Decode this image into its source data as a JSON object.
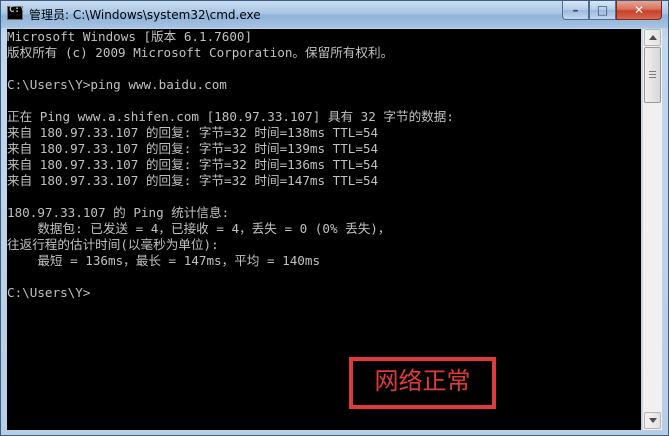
{
  "window": {
    "title": "管理员: C:\\Windows\\system32\\cmd.exe",
    "icon": "cmd-icon",
    "controls": {
      "minimize": "–",
      "maximize": "□",
      "close": "✕"
    }
  },
  "console": {
    "lines": [
      "Microsoft Windows [版本 6.1.7600]",
      "版权所有 (c) 2009 Microsoft Corporation。保留所有权利。",
      "",
      "C:\\Users\\Y>ping www.baidu.com",
      "",
      "正在 Ping www.a.shifen.com [180.97.33.107] 具有 32 字节的数据:",
      "来自 180.97.33.107 的回复: 字节=32 时间=138ms TTL=54",
      "来自 180.97.33.107 的回复: 字节=32 时间=139ms TTL=54",
      "来自 180.97.33.107 的回复: 字节=32 时间=136ms TTL=54",
      "来自 180.97.33.107 的回复: 字节=32 时间=147ms TTL=54",
      "",
      "180.97.33.107 的 Ping 统计信息:",
      "    数据包: 已发送 = 4，已接收 = 4，丢失 = 0 (0% 丢失)，",
      "往返行程的估计时间(以毫秒为单位):",
      "    最短 = 136ms，最长 = 147ms，平均 = 140ms",
      "",
      "C:\\Users\\Y>"
    ]
  },
  "annotation": {
    "text": "网络正常",
    "color": "#e03a3a"
  },
  "colors": {
    "console_bg": "#000000",
    "console_fg": "#c0c0c0"
  }
}
